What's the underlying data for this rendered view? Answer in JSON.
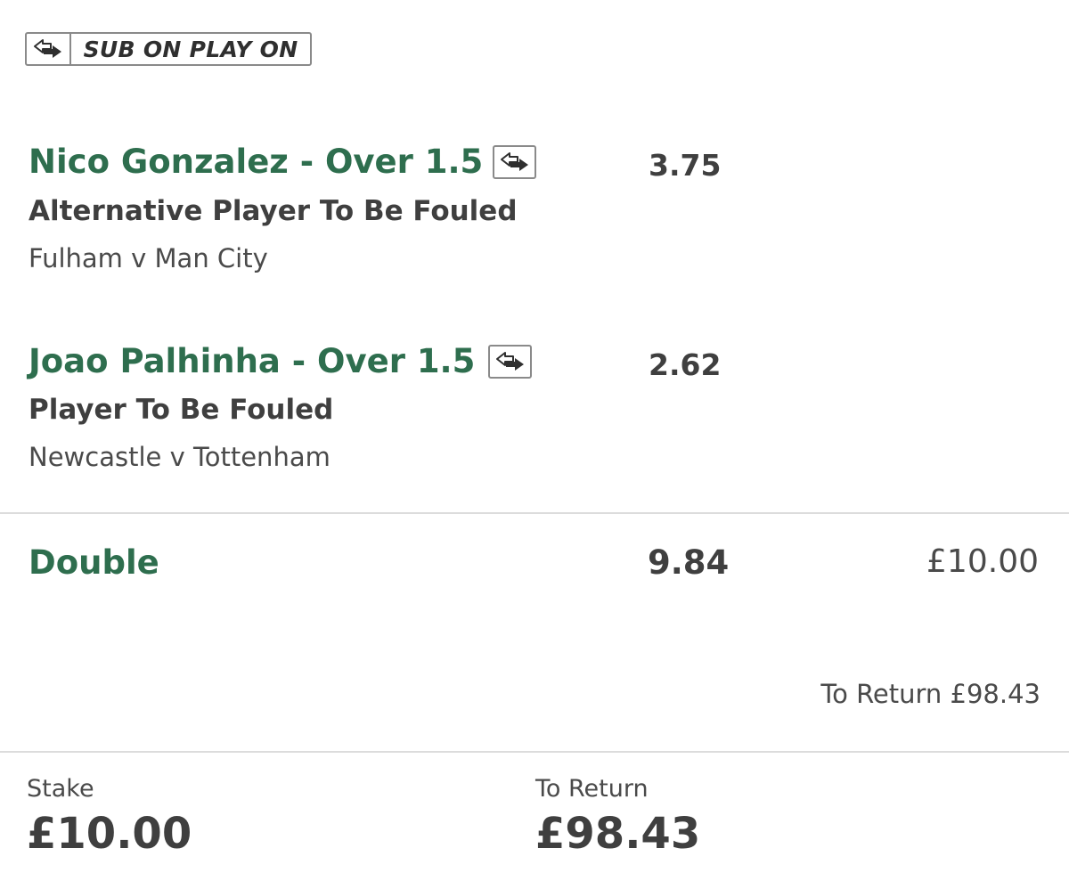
{
  "badge": {
    "icon": "swap-arrows-icon",
    "label": "SUB ON PLAY ON"
  },
  "selections": [
    {
      "title": "Nico Gonzalez - Over 1.5",
      "icon": "swap-arrows-icon",
      "market": "Alternative Player To Be Fouled",
      "event": "Fulham v Man City",
      "odds": "3.75"
    },
    {
      "title": "Joao Palhinha - Over 1.5",
      "icon": "swap-arrows-icon",
      "market": "Player To Be Fouled",
      "event": "Newcastle v Tottenham",
      "odds": "2.62"
    }
  ],
  "bet": {
    "type": "Double",
    "odds": "9.84",
    "stake": "£10.00",
    "to_return_line": "To Return £98.43"
  },
  "footer": {
    "stake_label": "Stake",
    "stake_value": "£10.00",
    "return_label": "To Return",
    "return_value": "£98.43"
  },
  "colors": {
    "accent_green": "#2e6e4e",
    "text_dark": "#3f3f3f",
    "border_grey": "#8a8a8a",
    "divider": "#dcdcdc"
  }
}
